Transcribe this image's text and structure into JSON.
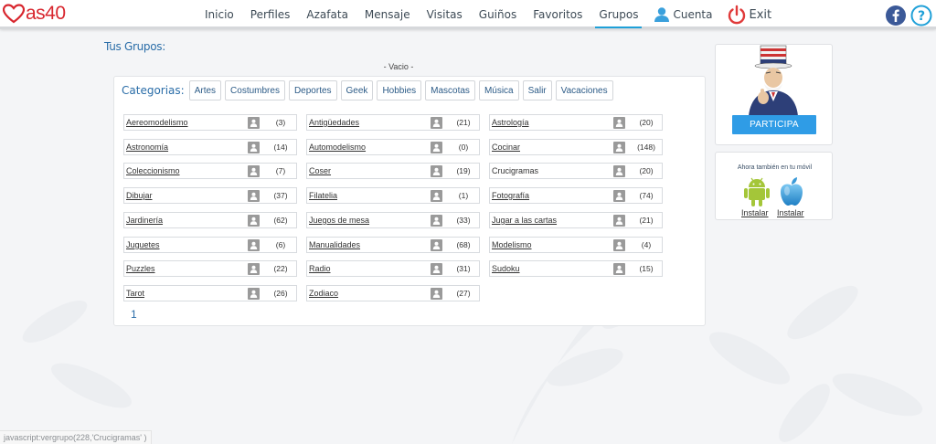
{
  "header": {
    "logo_text": "as40",
    "nav": [
      "Inicio",
      "Perfiles",
      "Azafata",
      "Mensaje",
      "Visitas",
      "Guiños",
      "Favoritos",
      "Grupos"
    ],
    "account_label": "Cuenta",
    "exit_label": "Exit",
    "active_nav": "Grupos"
  },
  "main": {
    "my_groups_label": "Tus Grupos:",
    "empty_label": "- Vacio -",
    "categories_label": "Categorias:",
    "categories": [
      "Artes",
      "Costumbres",
      "Deportes",
      "Geek",
      "Hobbies",
      "Mascotas",
      "Música",
      "Salir",
      "Vacaciones"
    ],
    "groups": [
      [
        {
          "name": "Aereomodelismo",
          "count": "(3)"
        },
        {
          "name": "Antigüedades",
          "count": "(21)"
        },
        {
          "name": "Astrología",
          "count": "(20)"
        }
      ],
      [
        {
          "name": "Astronomía",
          "count": "(14)"
        },
        {
          "name": "Automodelismo",
          "count": "(0)"
        },
        {
          "name": "Cocinar",
          "count": "(148)"
        }
      ],
      [
        {
          "name": "Coleccionismo",
          "count": "(7)"
        },
        {
          "name": "Coser",
          "count": "(19)"
        },
        {
          "name": "Crucigramas",
          "count": "(20)"
        }
      ],
      [
        {
          "name": "Dibujar",
          "count": "(37)"
        },
        {
          "name": "Filatelia",
          "count": "(1)"
        },
        {
          "name": "Fotografía",
          "count": "(74)"
        }
      ],
      [
        {
          "name": "Jardinería",
          "count": "(62)"
        },
        {
          "name": "Juegos de mesa",
          "count": "(33)"
        },
        {
          "name": "Jugar a las cartas",
          "count": "(21)"
        }
      ],
      [
        {
          "name": "Juguetes",
          "count": "(6)"
        },
        {
          "name": "Manualidades",
          "count": "(68)"
        },
        {
          "name": "Modelismo",
          "count": "(4)"
        }
      ],
      [
        {
          "name": "Puzzles",
          "count": "(22)"
        },
        {
          "name": "Radio",
          "count": "(31)"
        },
        {
          "name": "Sudoku",
          "count": "(15)"
        }
      ],
      [
        {
          "name": "Tarot",
          "count": "(26)"
        },
        {
          "name": "Zodiaco",
          "count": "(27)"
        }
      ]
    ],
    "hovered_group": "Crucigramas",
    "page": "1"
  },
  "sidebar": {
    "participa_label": "PARTICIPA",
    "app_title": "Ahora también en tu móvil",
    "android_install": "Instalar",
    "ios_install": "Instalar"
  },
  "statusbar": {
    "text": "javascript:vergrupo(228,'Crucigramas' )"
  },
  "colors": {
    "brand_red": "#d8262e",
    "link_blue": "#2a6da8",
    "accent_blue": "#1fa0d8",
    "participa_blue": "#2f9ce6",
    "android_green": "#a4c639"
  }
}
